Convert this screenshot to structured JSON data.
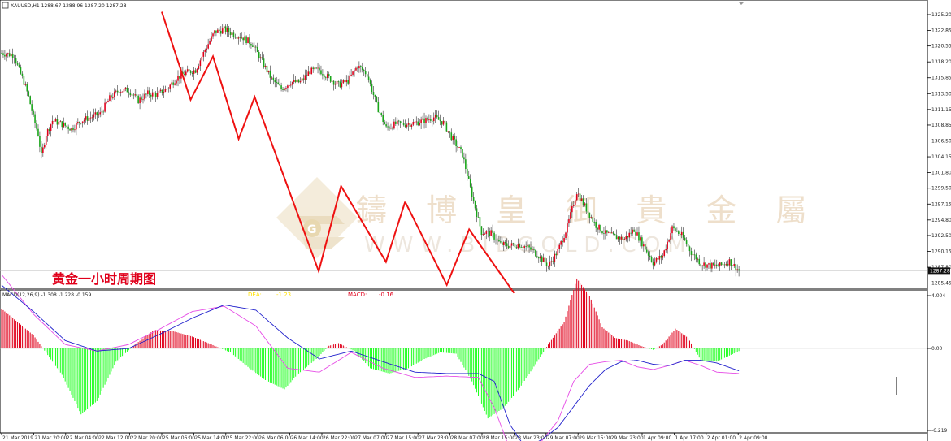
{
  "chart_data": [
    {
      "type": "candlestick",
      "symbol_header": "XAUUSD,H1  1288.67 1288.96 1287.20 1287.28",
      "annotation": "黄金一小时周期图",
      "watermark": {
        "cn": "鑄 博 皇 御 貴 金 屬",
        "en": "WWW.BIBGOLD.COM"
      },
      "ylim": [
        1284.8,
        1327.0
      ],
      "y_ticks": [
        "1325.20",
        "1322.85",
        "1320.55",
        "1318.20",
        "1315.85",
        "1313.50",
        "1311.15",
        "1308.85",
        "1306.50",
        "1304.15",
        "1301.80",
        "1299.50",
        "1297.15",
        "1294.80",
        "1292.50",
        "1290.15",
        "1287.80",
        "1285.45"
      ],
      "current_price": "1287.28",
      "colors": {
        "up": "#e0001b",
        "down": "#19a519",
        "wick": "#222222",
        "zigzag": "#ee1111"
      },
      "trend_points": [
        [
          0,
          1319.5
        ],
        [
          8,
          1319.2
        ],
        [
          10,
          1317.6
        ],
        [
          14,
          1315.2
        ],
        [
          17,
          1313.0
        ],
        [
          20,
          1310.0
        ],
        [
          23,
          1307.5
        ],
        [
          25,
          1304.2
        ],
        [
          28,
          1307.5
        ],
        [
          32,
          1309.5
        ],
        [
          38,
          1309.0
        ],
        [
          44,
          1308.3
        ],
        [
          50,
          1309.5
        ],
        [
          56,
          1310.0
        ],
        [
          62,
          1310.5
        ],
        [
          68,
          1312.8
        ],
        [
          74,
          1314.0
        ],
        [
          80,
          1314.0
        ],
        [
          86,
          1312.5
        ],
        [
          92,
          1313.5
        ],
        [
          98,
          1313.4
        ],
        [
          104,
          1314.2
        ],
        [
          110,
          1315.8
        ],
        [
          116,
          1316.6
        ],
        [
          122,
          1317.0
        ],
        [
          128,
          1320.0
        ],
        [
          134,
          1322.6
        ],
        [
          140,
          1323.0
        ],
        [
          146,
          1322.3
        ],
        [
          152,
          1321.8
        ],
        [
          158,
          1320.8
        ],
        [
          164,
          1318.2
        ],
        [
          170,
          1315.6
        ],
        [
          176,
          1314.2
        ],
        [
          182,
          1315.2
        ],
        [
          188,
          1315.2
        ],
        [
          194,
          1316.8
        ],
        [
          200,
          1317.0
        ],
        [
          206,
          1315.8
        ],
        [
          212,
          1314.8
        ],
        [
          218,
          1315.4
        ],
        [
          224,
          1317.6
        ],
        [
          230,
          1316.4
        ],
        [
          236,
          1311.8
        ],
        [
          242,
          1308.4
        ],
        [
          248,
          1309.0
        ],
        [
          254,
          1309.0
        ],
        [
          260,
          1309.2
        ],
        [
          266,
          1309.5
        ],
        [
          272,
          1310.0
        ],
        [
          278,
          1309.2
        ],
        [
          284,
          1306.7
        ],
        [
          290,
          1304.5
        ],
        [
          296,
          1298.5
        ],
        [
          302,
          1293.0
        ],
        [
          308,
          1292.8
        ],
        [
          314,
          1291.2
        ],
        [
          320,
          1291.0
        ],
        [
          326,
          1291.2
        ],
        [
          332,
          1290.6
        ],
        [
          338,
          1289.5
        ],
        [
          344,
          1288.0
        ],
        [
          350,
          1290.2
        ],
        [
          356,
          1293.8
        ],
        [
          362,
          1299.0
        ],
        [
          368,
          1296.4
        ],
        [
          374,
          1294.0
        ],
        [
          380,
          1292.8
        ],
        [
          386,
          1292.3
        ],
        [
          392,
          1292.0
        ],
        [
          398,
          1293.4
        ],
        [
          404,
          1291.0
        ],
        [
          410,
          1288.5
        ],
        [
          416,
          1289.5
        ],
        [
          422,
          1293.6
        ],
        [
          428,
          1292.5
        ],
        [
          434,
          1290.0
        ],
        [
          440,
          1288.4
        ],
        [
          446,
          1288.0
        ],
        [
          452,
          1288.0
        ],
        [
          458,
          1288.7
        ],
        [
          464,
          1287.3
        ]
      ],
      "zigzag_actual": [
        [
          1305.0,
          1325.6
        ],
        [
          1305.9,
          1312.6
        ],
        [
          1306.6,
          1319.0
        ],
        [
          1307.4,
          1306.8
        ],
        [
          1307.9,
          1313.0
        ],
        [
          1309.9,
          1287.2
        ],
        [
          1310.6,
          1299.8
        ],
        [
          1312.0,
          1288.6
        ],
        [
          1312.6,
          1297.5
        ]
      ],
      "zigzag_projection": [
        [
          1312.6,
          1297.5
        ],
        [
          1313.9,
          1285.2
        ],
        [
          1314.6,
          1293.4
        ],
        [
          1316.0,
          1284.0
        ]
      ],
      "x_tick_labels": [
        "21 Mar 2019",
        "21 Mar 20:00",
        "22 Mar 04:00",
        "22 Mar 12:00",
        "22 Mar 20:00",
        "25 Mar 06:00",
        "25 Mar 14:00",
        "25 Mar 22:00",
        "26 Mar 06:00",
        "26 Mar 14:00",
        "26 Mar 22:00",
        "27 Mar 07:00",
        "27 Mar 15:00",
        "27 Mar 23:00",
        "28 Mar 07:00",
        "28 Mar 15:00",
        "28 Mar 23:00",
        "29 Mar 07:00",
        "29 Mar 15:00",
        "29 Mar 23:00",
        "1 Apr 09:00",
        "1 Apr 17:00",
        "2 Apr 01:00",
        "2 Apr 09:00"
      ]
    },
    {
      "type": "histogram",
      "indicator_header": "MACD(12,26,9) -1.308 -1.228 -0.159",
      "readouts": [
        {
          "label": "DEA:",
          "value": "-1.23",
          "color": "#ffe100"
        },
        {
          "label": "MACD:",
          "value": "-0.16",
          "color": "#e0001b"
        }
      ],
      "ylim": [
        -6.219,
        4.004
      ],
      "y_ticks": [
        "4.004",
        "0.00",
        "-6.219"
      ],
      "histogram_points": [
        [
          0,
          3.0
        ],
        [
          20,
          1.0
        ],
        [
          38,
          -2.0
        ],
        [
          50,
          -5.0
        ],
        [
          60,
          -4.0
        ],
        [
          72,
          -1.0
        ],
        [
          84,
          0.3
        ],
        [
          96,
          1.4
        ],
        [
          108,
          1.3
        ],
        [
          120,
          0.9
        ],
        [
          132,
          0.3
        ],
        [
          144,
          -0.3
        ],
        [
          156,
          -1.5
        ],
        [
          166,
          -2.4
        ],
        [
          178,
          -3.1
        ],
        [
          186,
          -2.0
        ],
        [
          198,
          -0.8
        ],
        [
          206,
          0.2
        ],
        [
          212,
          0.4
        ],
        [
          222,
          -0.2
        ],
        [
          232,
          -1.5
        ],
        [
          244,
          -1.9
        ],
        [
          256,
          -1.5
        ],
        [
          266,
          -0.8
        ],
        [
          276,
          -0.3
        ],
        [
          286,
          -0.4
        ],
        [
          296,
          -2.5
        ],
        [
          306,
          -5.3
        ],
        [
          316,
          -4.5
        ],
        [
          326,
          -3.0
        ],
        [
          336,
          -1.2
        ],
        [
          344,
          0.3
        ],
        [
          354,
          2.0
        ],
        [
          362,
          5.3
        ],
        [
          370,
          4.0
        ],
        [
          378,
          1.6
        ],
        [
          386,
          0.8
        ],
        [
          394,
          0.6
        ],
        [
          402,
          0.2
        ],
        [
          410,
          -0.1
        ],
        [
          416,
          0.3
        ],
        [
          424,
          1.5
        ],
        [
          432,
          0.8
        ],
        [
          440,
          -0.9
        ],
        [
          450,
          -1.0
        ],
        [
          464,
          -0.2
        ]
      ],
      "signal_points": [
        [
          0,
          5.6
        ],
        [
          20,
          2.6
        ],
        [
          40,
          0.3
        ],
        [
          60,
          -0.2
        ],
        [
          80,
          0.3
        ],
        [
          100,
          1.5
        ],
        [
          120,
          2.8
        ],
        [
          140,
          3.2
        ],
        [
          160,
          1.7
        ],
        [
          180,
          -1.5
        ],
        [
          200,
          -1.8
        ],
        [
          220,
          -0.3
        ],
        [
          240,
          -1.5
        ],
        [
          260,
          -2.2
        ],
        [
          280,
          -2.1
        ],
        [
          300,
          -2.2
        ],
        [
          310,
          -4.5
        ],
        [
          320,
          -7.7
        ],
        [
          330,
          -8.0
        ],
        [
          340,
          -7.0
        ],
        [
          350,
          -5.5
        ],
        [
          360,
          -2.5
        ],
        [
          370,
          -1.2
        ],
        [
          380,
          -1.0
        ],
        [
          390,
          -0.9
        ],
        [
          400,
          -1.4
        ],
        [
          410,
          -1.6
        ],
        [
          420,
          -1.3
        ],
        [
          430,
          -0.9
        ],
        [
          440,
          -1.3
        ],
        [
          450,
          -1.8
        ],
        [
          464,
          -1.9
        ]
      ],
      "macd_points": [
        [
          0,
          4.8
        ],
        [
          20,
          2.8
        ],
        [
          40,
          0.6
        ],
        [
          60,
          -0.2
        ],
        [
          80,
          0.0
        ],
        [
          100,
          1.1
        ],
        [
          120,
          2.3
        ],
        [
          140,
          3.3
        ],
        [
          160,
          2.9
        ],
        [
          180,
          0.8
        ],
        [
          200,
          -0.8
        ],
        [
          220,
          -0.2
        ],
        [
          240,
          -1.0
        ],
        [
          260,
          -1.8
        ],
        [
          280,
          -1.9
        ],
        [
          300,
          -1.9
        ],
        [
          310,
          -2.5
        ],
        [
          320,
          -5.8
        ],
        [
          330,
          -7.6
        ],
        [
          340,
          -6.9
        ],
        [
          350,
          -6.0
        ],
        [
          360,
          -4.4
        ],
        [
          370,
          -2.8
        ],
        [
          380,
          -1.6
        ],
        [
          390,
          -1.0
        ],
        [
          400,
          -0.9
        ],
        [
          410,
          -1.2
        ],
        [
          420,
          -1.3
        ],
        [
          430,
          -0.9
        ],
        [
          440,
          -0.9
        ],
        [
          450,
          -1.1
        ],
        [
          464,
          -1.7
        ]
      ]
    }
  ]
}
